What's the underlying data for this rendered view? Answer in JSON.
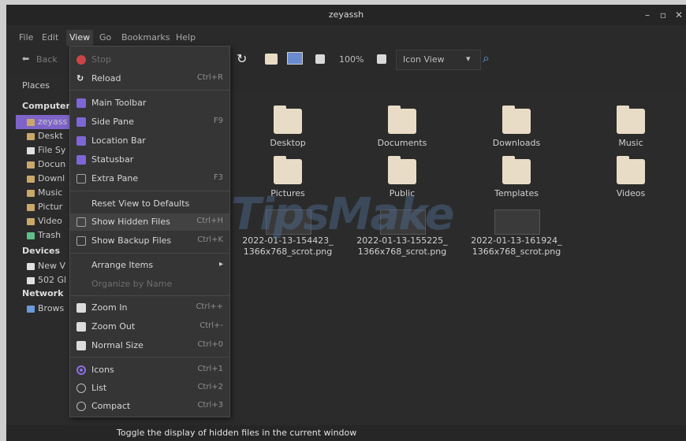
{
  "window": {
    "title": "zeyassh"
  },
  "menubar": {
    "items": [
      "File",
      "Edit",
      "View",
      "Go",
      "Bookmarks",
      "Help"
    ]
  },
  "toolbar": {
    "back": "Back",
    "zoom": "100%",
    "view_mode": "Icon View"
  },
  "places": {
    "header": "Places",
    "computer": "Computer",
    "computer_items": [
      "zeyass",
      "Deskt",
      "File Sy",
      "Docun",
      "Downl",
      "Music",
      "Pictur",
      "Video",
      "Trash"
    ],
    "devices": "Devices",
    "devices_items": [
      "New V",
      "502 Gl"
    ],
    "network": "Network",
    "network_items": [
      "Brows"
    ]
  },
  "view_menu": {
    "stop": "Stop",
    "reload": "Reload",
    "reload_acc": "Ctrl+R",
    "main_toolbar": "Main Toolbar",
    "side_pane": "Side Pane",
    "side_pane_acc": "F9",
    "location_bar": "Location Bar",
    "statusbar": "Statusbar",
    "extra_pane": "Extra Pane",
    "extra_pane_acc": "F3",
    "reset_view": "Reset View to Defaults",
    "show_hidden": "Show Hidden Files",
    "show_hidden_acc": "Ctrl+H",
    "show_backup": "Show Backup Files",
    "show_backup_acc": "Ctrl+K",
    "arrange": "Arrange Items",
    "organize": "Organize by Name",
    "zoom_in": "Zoom In",
    "zoom_in_acc": "Ctrl++",
    "zoom_out": "Zoom Out",
    "zoom_out_acc": "Ctrl+-",
    "normal_size": "Normal Size",
    "normal_size_acc": "Ctrl+0",
    "icons": "Icons",
    "icons_acc": "Ctrl+1",
    "list": "List",
    "list_acc": "Ctrl+2",
    "compact": "Compact",
    "compact_acc": "Ctrl+3"
  },
  "files": {
    "desktop": "Desktop",
    "documents": "Documents",
    "downloads": "Downloads",
    "music": "Music",
    "pictures": "Pictures",
    "public": "Public",
    "templates": "Templates",
    "videos": "Videos",
    "shot1_a": "2022-01-13-154423_",
    "shot1_b": "1366x768_scrot.png",
    "shot2_a": "2022-01-13-155225_",
    "shot2_b": "1366x768_scrot.png",
    "shot3_a": "2022-01-13-161924_",
    "shot3_b": "1366x768_scrot.png"
  },
  "status": {
    "text": "Toggle the display of hidden files in the current window"
  },
  "watermark": "TipsMake",
  "colors": {
    "accent": "#7f66d6",
    "background": "#2a2a2a",
    "menu": "#353535",
    "folder": "#e9dcc6"
  }
}
